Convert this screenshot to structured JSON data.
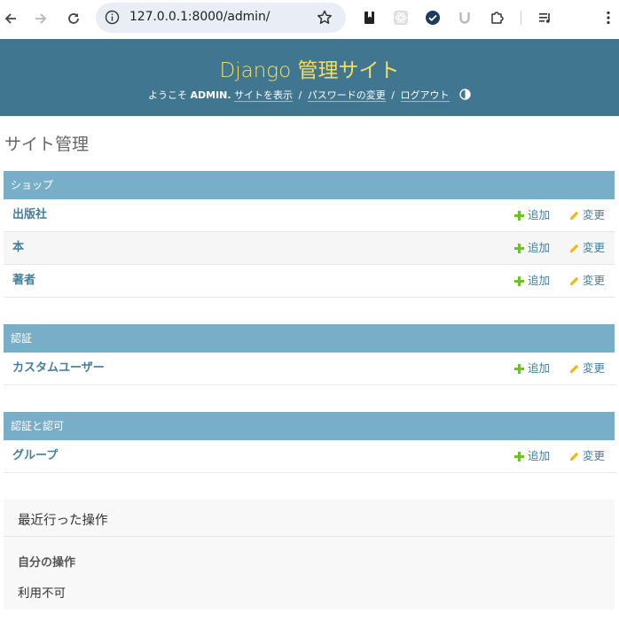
{
  "browser": {
    "url": "127.0.0.1:8000/admin/"
  },
  "header": {
    "branding": "Django 管理サイト",
    "welcome": "ようこそ",
    "username": "ADMIN.",
    "view_site": "サイトを表示",
    "sep1": "/",
    "password_change": "パスワードの変更",
    "sep2": "/",
    "logout": "ログアウト"
  },
  "page_title": "サイト管理",
  "modules": [
    {
      "caption": "ショップ",
      "models": [
        {
          "name": "出版社",
          "add": "追加",
          "change": "変更"
        },
        {
          "name": "本",
          "add": "追加",
          "change": "変更"
        },
        {
          "name": "著者",
          "add": "追加",
          "change": "変更"
        }
      ]
    },
    {
      "caption": "認証",
      "models": [
        {
          "name": "カスタムユーザー",
          "add": "追加",
          "change": "変更"
        }
      ]
    },
    {
      "caption": "認証と認可",
      "models": [
        {
          "name": "グループ",
          "add": "追加",
          "change": "変更"
        }
      ]
    }
  ],
  "recent_actions": {
    "title": "最近行った操作",
    "my_actions": "自分の操作",
    "none": "利用不可"
  },
  "colors": {
    "header_bg": "#417690",
    "branding": "#f5dd5d",
    "caption_bg": "#79aec8",
    "link": "#447e9b",
    "add_icon": "#70bf2b",
    "change_icon": "#efb80b"
  }
}
